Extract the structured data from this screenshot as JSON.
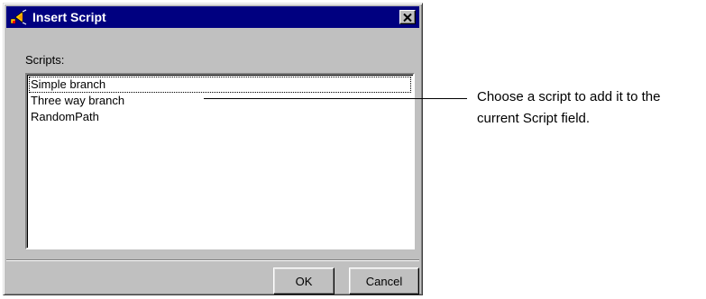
{
  "dialog": {
    "title": "Insert Script",
    "close_glyph": "✕",
    "icon": "script-app-icon"
  },
  "scripts_label": "Scripts:",
  "scripts": [
    {
      "label": "Simple branch",
      "focused": true
    },
    {
      "label": "Three way branch",
      "focused": false
    },
    {
      "label": "RandomPath",
      "focused": false
    }
  ],
  "buttons": {
    "ok": "OK",
    "cancel": "Cancel"
  },
  "callout": {
    "line1": "Choose a script to add it to the",
    "line2": "current Script field."
  },
  "colors": {
    "titlebar": "#000080",
    "face": "#c0c0c0"
  }
}
